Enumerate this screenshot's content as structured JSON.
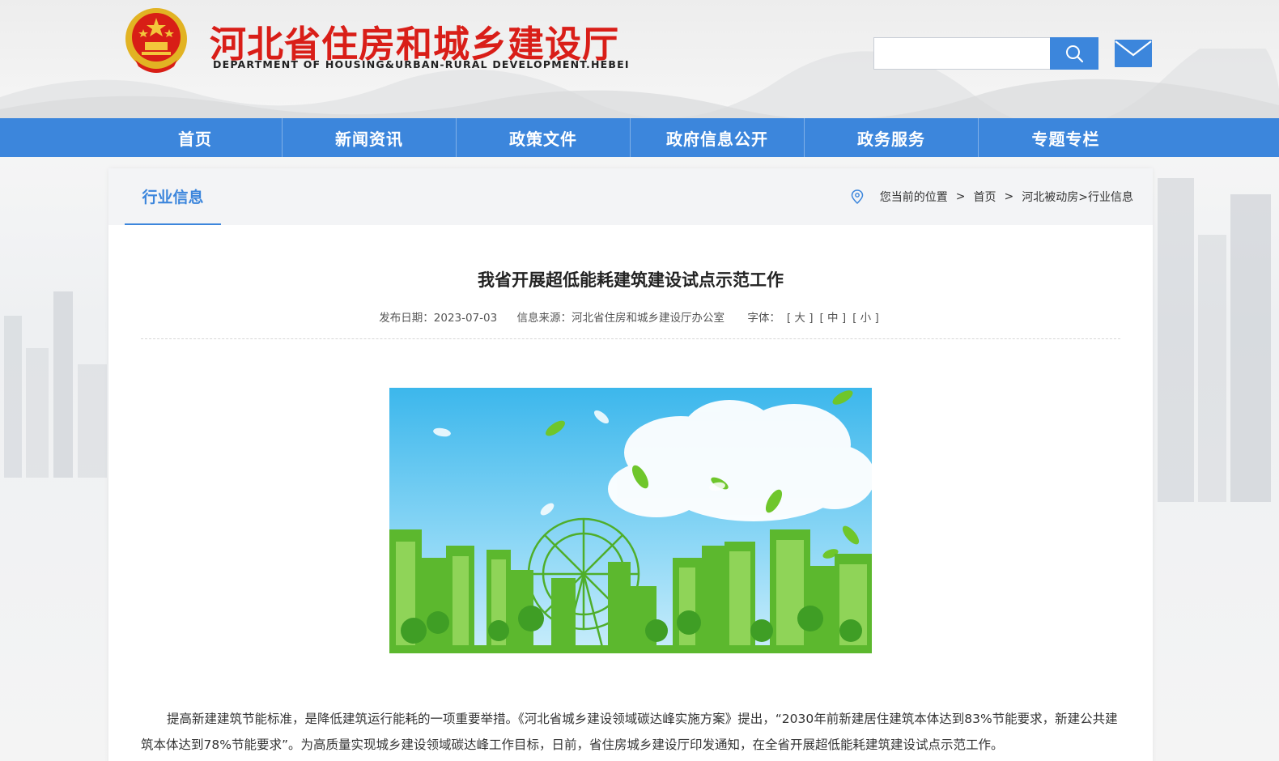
{
  "header": {
    "title": "河北省住房和城乡建设厅",
    "subtitle": "DEPARTMENT OF HOUSING&URBAN-RURAL DEVELOPMENT.HEBEI",
    "search_placeholder": "",
    "emblem_icon": "national-emblem-icon",
    "search_icon": "search-icon",
    "mail_icon": "mail-icon"
  },
  "nav": {
    "items": [
      {
        "label": "首页"
      },
      {
        "label": "新闻资讯"
      },
      {
        "label": "政策文件"
      },
      {
        "label": "政府信息公开"
      },
      {
        "label": "政务服务"
      },
      {
        "label": "专题专栏"
      }
    ]
  },
  "section": {
    "title": "行业信息"
  },
  "breadcrumb": {
    "prefix": "您当前的位置",
    "separator": ">",
    "home": "首页",
    "path": "河北被动房>行业信息"
  },
  "article": {
    "title": "我省开展超低能耗建筑建设试点示范工作",
    "date_label": "发布日期：2023-07-03",
    "source_label": "信息来源：河北省住房和城乡建设厅办公室",
    "font_label": "字体：",
    "font_large": "[ 大 ]",
    "font_medium": "[ 中 ]",
    "font_small": "[ 小 ]",
    "body": "提高新建建筑节能标准，是降低建筑运行能耗的一项重要举措。《河北省城乡建设领域碳达峰实施方案》提出，“2030年前新建居住建筑本体达到83%节能要求，新建公共建筑本体达到78%节能要求”。为高质量实现城乡建设领域碳达峰工作目标，日前，省住房城乡建设厅印发通知，在全省开展超低能耗建筑建设试点示范工作。"
  },
  "colors": {
    "brand_red": "#d91e18",
    "nav_blue": "#3c86dc",
    "text_dark": "#222222"
  }
}
